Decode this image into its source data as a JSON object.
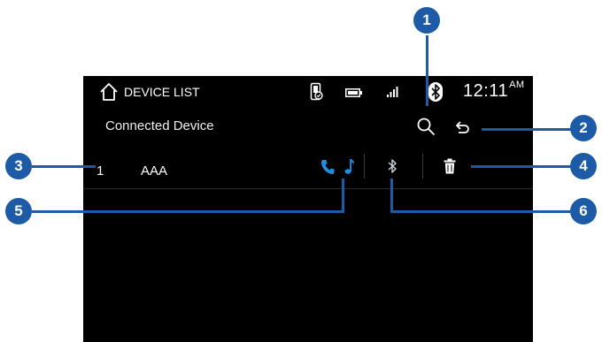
{
  "header": {
    "title": "DEVICE LIST",
    "time": "12:11",
    "ampm": "AM",
    "icons": [
      "home-icon",
      "phone-projection-icon",
      "battery-icon",
      "signal-icon",
      "bluetooth-status-icon"
    ]
  },
  "subheader": {
    "label": "Connected Device",
    "actions": [
      "search-icon",
      "back-icon"
    ]
  },
  "devices": [
    {
      "index": "1",
      "name": "AAA",
      "icons": [
        "phone-icon",
        "music-note-icon",
        "bluetooth-icon",
        "trash-icon"
      ]
    }
  ],
  "callouts": [
    "1",
    "2",
    "3",
    "4",
    "5",
    "6"
  ],
  "colors": {
    "accent": "#1d5ba6",
    "connected": "#1e8fe0",
    "screen": "#000000"
  }
}
